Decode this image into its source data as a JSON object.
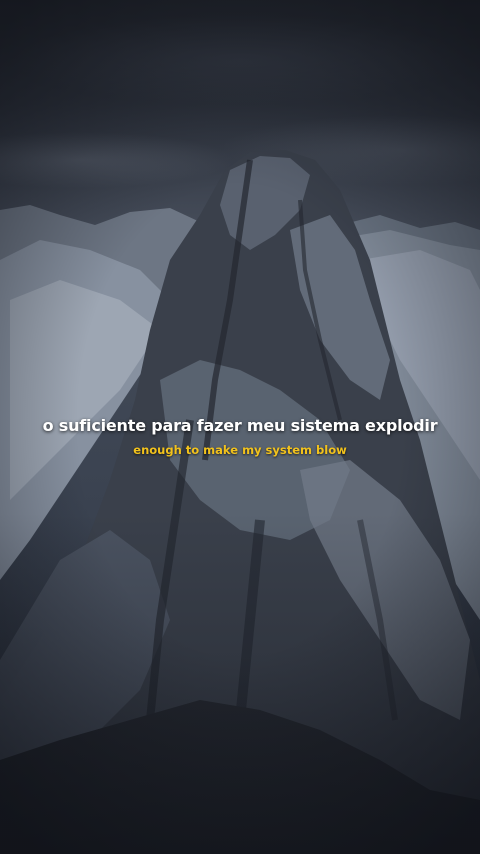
{
  "scene": {
    "description_icon": "snowy-mountain-peak-photo",
    "sky_color": "#2c313b",
    "rock_color": "#2b3039",
    "snow_color": "#9aa3b0"
  },
  "subtitles": {
    "main": "o suficiente para fazer meu sistema explodir",
    "translation": "enough to make my system blow",
    "main_color": "#ffffff",
    "translation_color": "#f2c21c"
  }
}
